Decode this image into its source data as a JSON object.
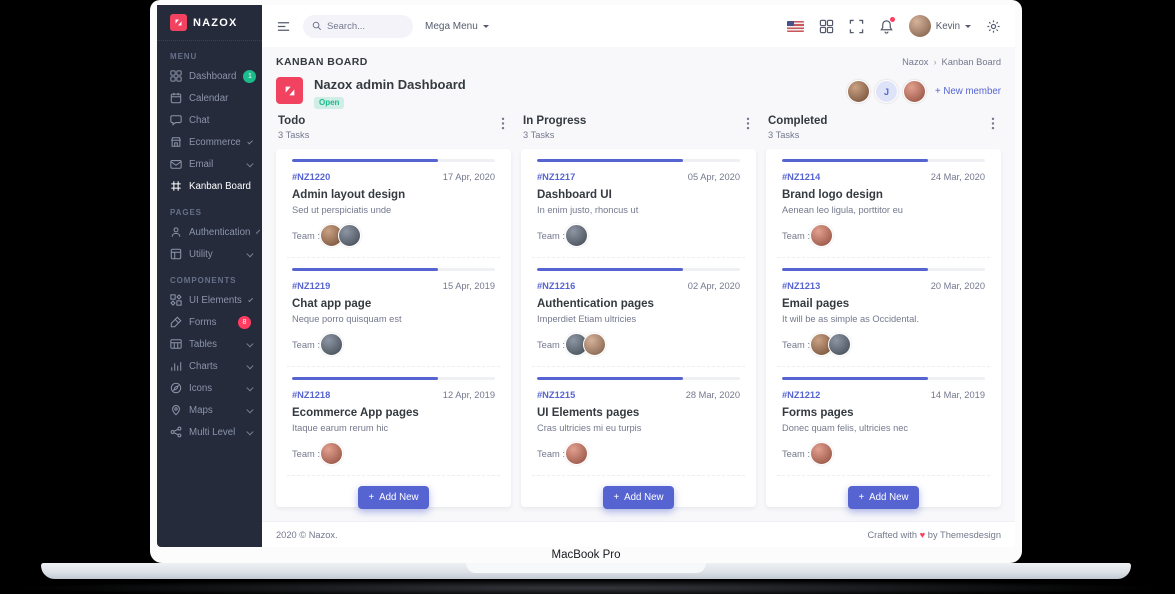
{
  "device": {
    "label": "MacBook Pro"
  },
  "brand": {
    "name": "NAZOX"
  },
  "topbar": {
    "search_placeholder": "Search...",
    "mega_menu": "Mega Menu",
    "user": "Kevin"
  },
  "sidebar": {
    "sections": [
      {
        "title": "MENU",
        "items": [
          {
            "label": "Dashboard",
            "badge": "1"
          },
          {
            "label": "Calendar"
          },
          {
            "label": "Chat"
          },
          {
            "label": "Ecommerce"
          },
          {
            "label": "Email"
          },
          {
            "label": "Kanban Board"
          }
        ]
      },
      {
        "title": "PAGES",
        "items": [
          {
            "label": "Authentication"
          },
          {
            "label": "Utility"
          }
        ]
      },
      {
        "title": "COMPONENTS",
        "items": [
          {
            "label": "UI Elements"
          },
          {
            "label": "Forms",
            "badge": "8"
          },
          {
            "label": "Tables"
          },
          {
            "label": "Charts"
          },
          {
            "label": "Icons"
          },
          {
            "label": "Maps"
          },
          {
            "label": "Multi Level"
          }
        ]
      }
    ]
  },
  "page": {
    "title": "KANBAN BOARD",
    "breadcrumb": {
      "home": "Nazox",
      "sep": "›",
      "current": "Kanban Board"
    },
    "project": {
      "name": "Nazox admin Dashboard",
      "status": "Open",
      "team_badge": "J",
      "new_member": "+ New member"
    }
  },
  "board": {
    "team_label": "Team :",
    "add_plus": "+",
    "add_new": "Add New",
    "columns": [
      {
        "title": "Todo",
        "tasks": "3 Tasks",
        "cards": [
          {
            "id": "#NZ1220",
            "date": "17 Apr, 2020",
            "title": "Admin layout design",
            "desc": "Sed ut perspiciatis unde",
            "progress": 72
          },
          {
            "id": "#NZ1219",
            "date": "15 Apr, 2019",
            "title": "Chat app page",
            "desc": "Neque porro quisquam est",
            "progress": 72
          },
          {
            "id": "#NZ1218",
            "date": "12 Apr, 2019",
            "title": "Ecommerce App pages",
            "desc": "Itaque earum rerum hic",
            "progress": 72
          }
        ]
      },
      {
        "title": "In Progress",
        "tasks": "3 Tasks",
        "cards": [
          {
            "id": "#NZ1217",
            "date": "05 Apr, 2020",
            "title": "Dashboard UI",
            "desc": "In enim justo, rhoncus ut",
            "progress": 72
          },
          {
            "id": "#NZ1216",
            "date": "02 Apr, 2020",
            "title": "Authentication pages",
            "desc": "Imperdiet Etiam ultricies",
            "progress": 72
          },
          {
            "id": "#NZ1215",
            "date": "28 Mar, 2020",
            "title": "UI Elements pages",
            "desc": "Cras ultricies mi eu turpis",
            "progress": 72
          }
        ]
      },
      {
        "title": "Completed",
        "tasks": "3 Tasks",
        "cards": [
          {
            "id": "#NZ1214",
            "date": "24 Mar, 2020",
            "title": "Brand logo design",
            "desc": "Aenean leo ligula, porttitor eu",
            "progress": 72
          },
          {
            "id": "#NZ1213",
            "date": "20 Mar, 2020",
            "title": "Email pages",
            "desc": "It will be as simple as Occidental.",
            "progress": 72
          },
          {
            "id": "#NZ1212",
            "date": "14 Mar, 2019",
            "title": "Forms pages",
            "desc": "Donec quam felis, ultricies nec",
            "progress": 72
          }
        ]
      }
    ]
  },
  "footer": {
    "copyright": "2020 © Nazox.",
    "crafted_prefix": "Crafted with",
    "heart": "♥",
    "crafted_suffix": "by Themesdesign"
  },
  "colors": {
    "primary": "#5664d2",
    "success": "#1cbb8c",
    "danger": "#ff3d60",
    "sidebar_bg": "#252b3b",
    "logo": "#f1425f"
  }
}
